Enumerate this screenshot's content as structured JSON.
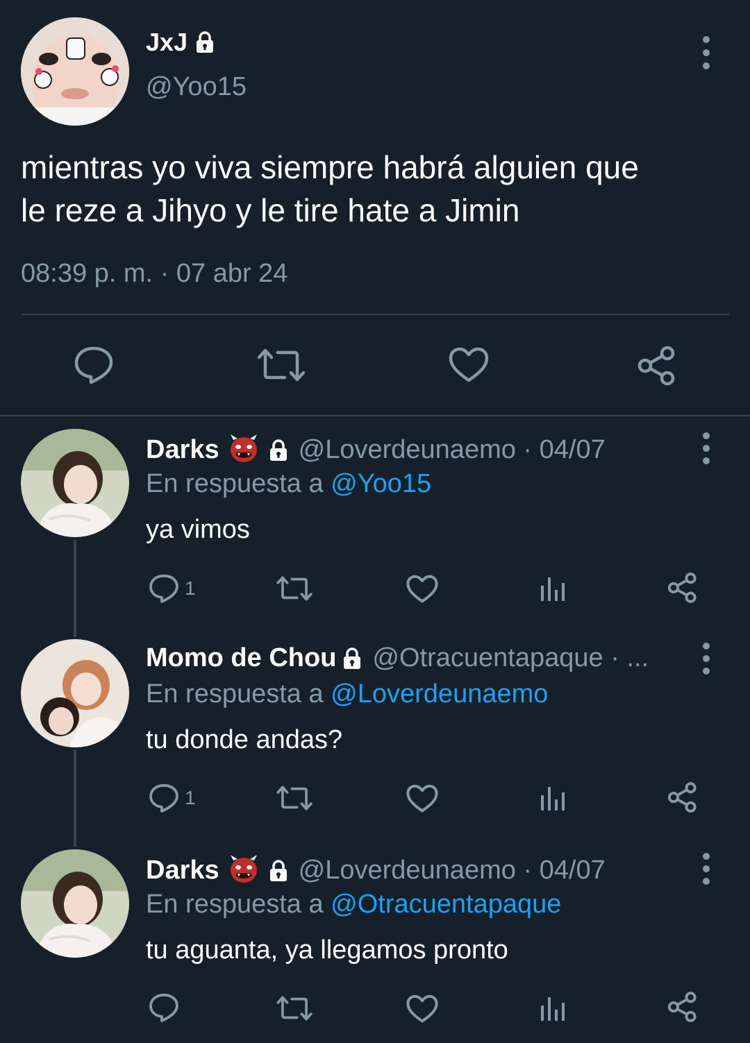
{
  "main_tweet": {
    "display_name": "JxJ",
    "handle": "@Yoo15",
    "text_line1": "mientras yo viva siempre habrá alguien que",
    "text_line2": "le reze a Jihyo y le tire hate a Jimin",
    "timestamp": "08:39 p. m. · 07 abr 24",
    "icons": [
      "reply-icon",
      "retweet-icon",
      "like-icon",
      "share-icon"
    ]
  },
  "replies": [
    {
      "display_name": "Darks",
      "emoji": "ogre-emoji",
      "handle_date": "@Loverdeunaemo · 04/07",
      "reply_prefix": "En respuesta a",
      "reply_to": "@Yoo15",
      "text": "ya vimos",
      "reply_count": "1"
    },
    {
      "display_name": "Momo de Chou",
      "handle_date": "@Otracuentapaque · ...",
      "reply_prefix": "En respuesta a",
      "reply_to": "@Loverdeunaemo",
      "text": "tu donde andas?",
      "reply_count": "1"
    },
    {
      "display_name": "Darks",
      "emoji": "ogre-emoji",
      "handle_date": "@Loverdeunaemo · 04/07",
      "reply_prefix": "En respuesta a",
      "reply_to": "@Otracuentapaque",
      "text": "tu aguanta, ya llegamos pronto",
      "reply_count": ""
    }
  ],
  "colors": {
    "background": "#15202b",
    "muted": "#8899a6",
    "link": "#1da1f2",
    "divider": "#38444d"
  }
}
